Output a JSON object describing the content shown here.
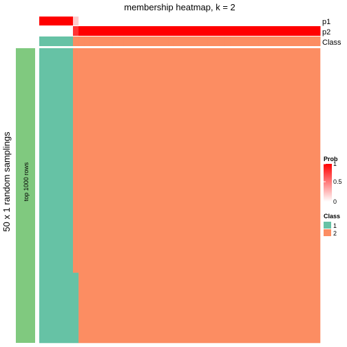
{
  "chart_data": {
    "type": "heatmap",
    "title": "membership heatmap, k = 2",
    "ylabel": "50 x 1 random samplings",
    "row_group_label": "top 1000 rows",
    "n_columns": 50,
    "n_rows": 1000,
    "annotation_rows": [
      {
        "name": "p1",
        "values_by_column": {
          "default": 0,
          "ranges": [
            {
              "from": 0,
              "to": 5,
              "value": 1.0
            },
            {
              "from": 6,
              "to": 6,
              "value": 0.2
            }
          ]
        }
      },
      {
        "name": "p2",
        "values_by_column": {
          "default": 1,
          "ranges": [
            {
              "from": 0,
              "to": 5,
              "value": 0.0
            },
            {
              "from": 6,
              "to": 6,
              "value": 0.8
            }
          ]
        }
      },
      {
        "name": "Class",
        "values_by_column": {
          "default": 2,
          "ranges": [
            {
              "from": 0,
              "to": 5,
              "value": 1
            }
          ]
        }
      }
    ],
    "membership_blocks": [
      {
        "col_from": 0,
        "col_to": 5,
        "row_from": 0,
        "row_to": 999,
        "class": 1
      },
      {
        "col_from": 6,
        "col_to": 6,
        "row_from": 0,
        "row_to": 761,
        "class": 2
      },
      {
        "col_from": 6,
        "col_to": 6,
        "row_from": 762,
        "row_to": 999,
        "class": 1
      },
      {
        "col_from": 7,
        "col_to": 49,
        "row_from": 0,
        "row_to": 999,
        "class": 2
      }
    ],
    "legends": {
      "prob": {
        "title": "Prob",
        "ticks": [
          "1",
          "0.5",
          "0"
        ],
        "range": [
          0,
          1
        ],
        "color_low": "#FFFFFF",
        "color_high": "#FF0000"
      },
      "class": {
        "title": "Class",
        "entries": [
          {
            "label": "1",
            "color": "#66C2A5"
          },
          {
            "label": "2",
            "color": "#FC8D62"
          }
        ]
      }
    },
    "group_bar_color": "#80C97F"
  }
}
